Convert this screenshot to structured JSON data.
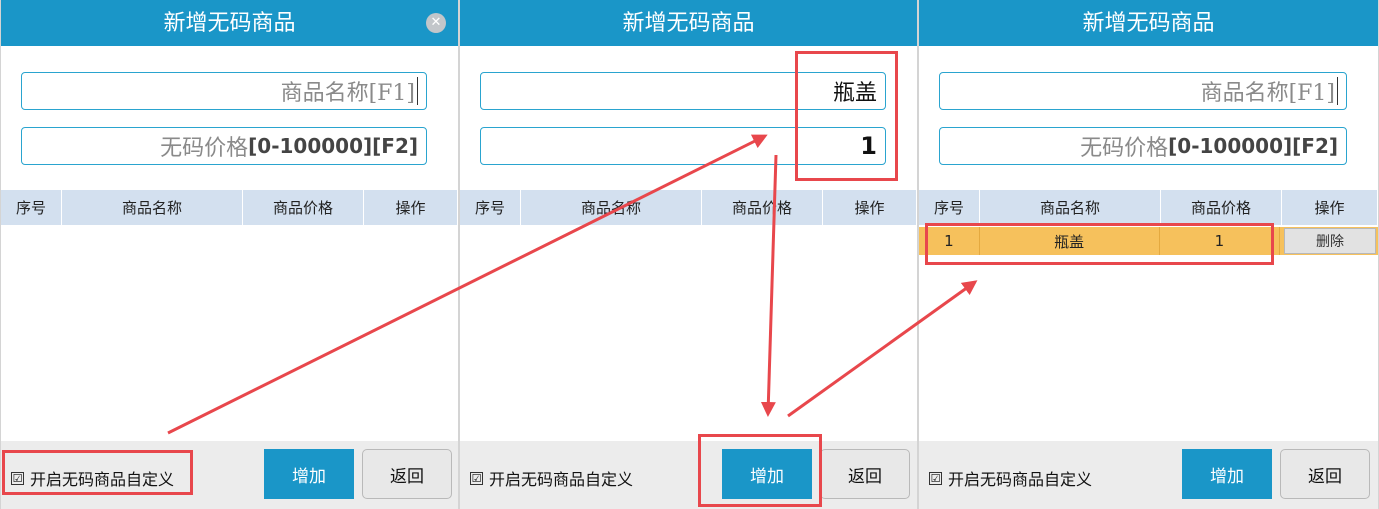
{
  "dialog": {
    "title": "新增无码商品",
    "name_placeholder": "商品名称[F1]",
    "price_placeholder_main": "无码价格",
    "price_placeholder_range": "[0-100000][F2]",
    "table_headers": [
      "序号",
      "商品名称",
      "商品价格",
      "操作"
    ],
    "checkbox_label": "开启无码商品自定义",
    "checkbox_mark": "☑",
    "add_button": "增加",
    "back_button": "返回",
    "close_symbol": "✕"
  },
  "panel2": {
    "name_value": "瓶盖",
    "price_value": "1"
  },
  "panel3": {
    "row": {
      "index": "1",
      "name": "瓶盖",
      "price": "1",
      "action": "删除"
    }
  },
  "colors": {
    "title_bar": "#1a96c8",
    "highlight": "#e8474c",
    "row_selected": "#f6c15c",
    "header_bg": "#d3e0ef"
  }
}
